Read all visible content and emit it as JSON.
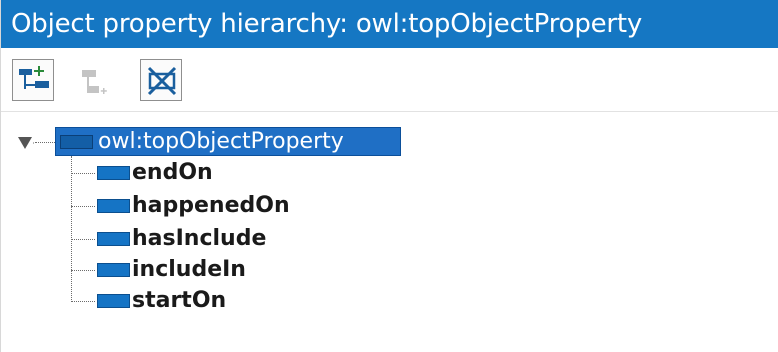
{
  "window": {
    "title": "Object property hierarchy: owl:topObjectProperty"
  },
  "toolbar": {
    "buttons": [
      {
        "icon": "add-subproperty-icon",
        "enabled": true
      },
      {
        "icon": "add-sibling-property-icon",
        "enabled": false
      },
      {
        "icon": "delete-property-icon",
        "enabled": true
      }
    ]
  },
  "tree": {
    "root": {
      "label": "owl:topObjectProperty",
      "expanded": true,
      "selected": true
    },
    "children": [
      {
        "label": "endOn"
      },
      {
        "label": "happenedOn"
      },
      {
        "label": "hasInclude"
      },
      {
        "label": "includeIn"
      },
      {
        "label": "startOn"
      }
    ]
  },
  "colors": {
    "title_bar": "#1577c3",
    "selection": "#1f6fc5",
    "property_icon": "#1574c5"
  }
}
